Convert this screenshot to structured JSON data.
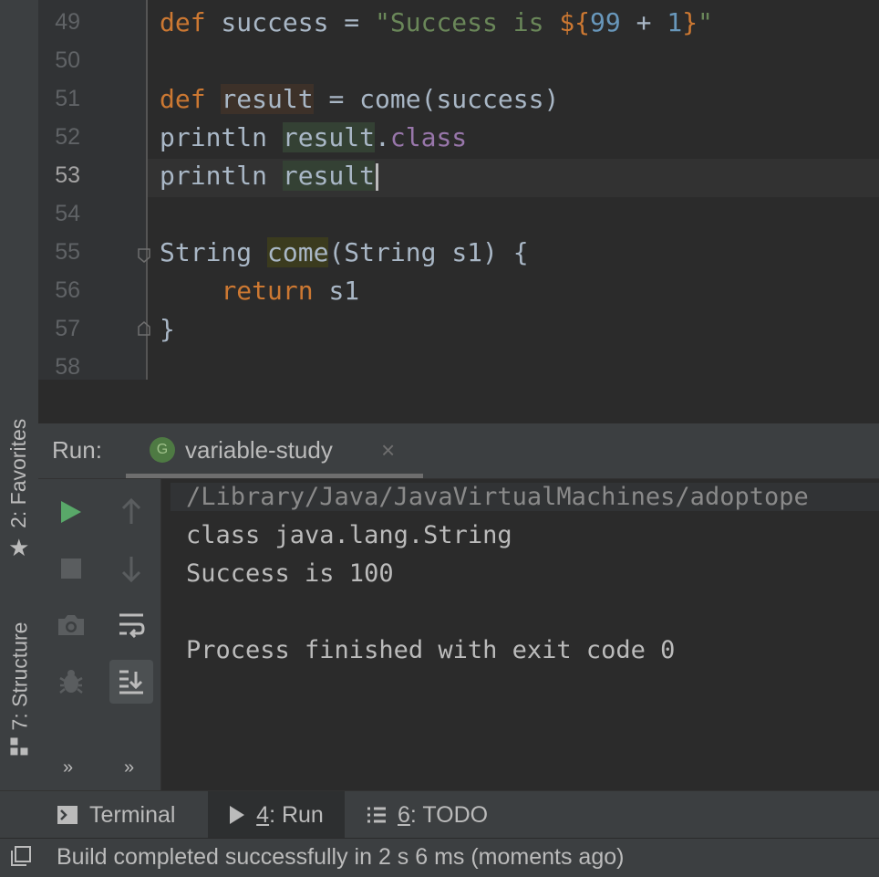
{
  "sidebar": {
    "favorites_label": "2: Favorites",
    "structure_label": "7: Structure"
  },
  "editor": {
    "line_numbers": [
      "49",
      "50",
      "51",
      "52",
      "53",
      "54",
      "55",
      "56",
      "57",
      "58"
    ],
    "current_line": "53",
    "code": {
      "l49_kw": "def",
      "l49_name": " success = ",
      "l49_str1": "\"Success is ",
      "l49_interp_open": "${",
      "l49_n1": "99",
      "l49_plus": " + ",
      "l49_n2": "1",
      "l49_interp_close": "}",
      "l49_str2": "\"",
      "l51_kw": "def",
      "l51_sp": " ",
      "l51_var": "result",
      "l51_rest": " = come(success)",
      "l52_fn": "println ",
      "l52_var": "result",
      "l52_dot": ".",
      "l52_prop": "class",
      "l53_fn": "println ",
      "l53_var": "result",
      "l55_type": "String ",
      "l55_fn": "come",
      "l55_rest": "(String s1) {",
      "l56_indent": "    ",
      "l56_kw": "return",
      "l56_rest": " s1",
      "l57": "}"
    }
  },
  "run": {
    "title": "Run:",
    "tab_badge": "G",
    "tab_label": "variable-study",
    "tab_close": "×",
    "more": "»",
    "console": [
      "/Library/Java/JavaVirtualMachines/adoptope",
      "class java.lang.String",
      "Success is 100",
      "",
      "Process finished with exit code 0"
    ]
  },
  "bottom_tabs": {
    "terminal": "Terminal",
    "run_num": "4",
    "run_rest": ": Run",
    "todo_num": "6",
    "todo_rest": ": TODO"
  },
  "status": {
    "text": "Build completed successfully in 2 s 6 ms (moments ago)"
  },
  "colors": {
    "keyword": "#cc7832",
    "string": "#6a8759",
    "number": "#6897bb",
    "property": "#9876aa",
    "run_green": "#59a869"
  }
}
